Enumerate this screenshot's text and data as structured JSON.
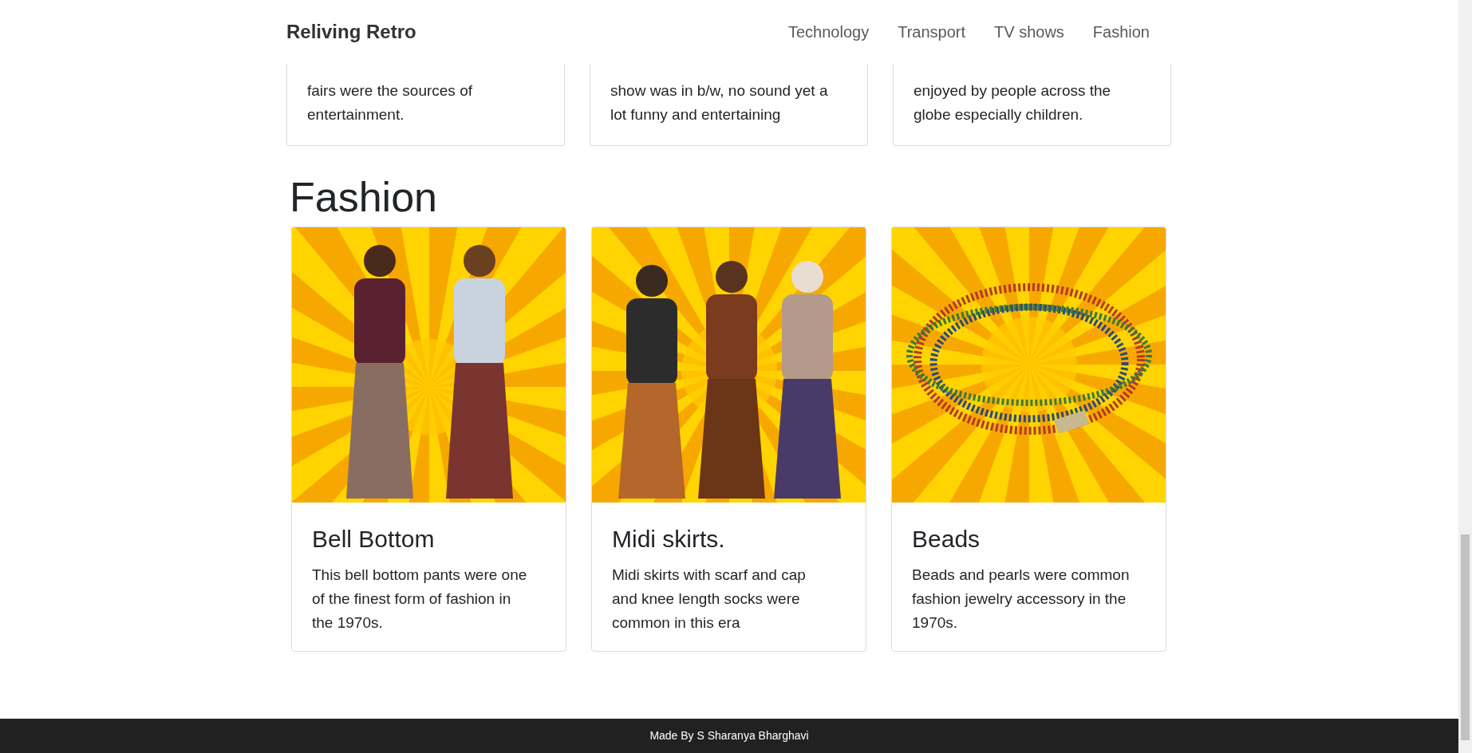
{
  "navbar": {
    "brand": "Reliving Retro",
    "links": [
      "Technology",
      "Transport",
      "TV shows",
      "Fashion"
    ]
  },
  "previous_cards": [
    {
      "text": "fairs were the sources of entertainment."
    },
    {
      "text": "show was in b/w, no sound yet a lot funny and entertaining"
    },
    {
      "text": "enjoyed by people across the globe especially children."
    }
  ],
  "section": {
    "heading": "Fashion",
    "cards": [
      {
        "title": "Bell Bottom",
        "text": "This bell bottom pants were one of the finest form of fashion in the 1970s."
      },
      {
        "title": "Midi skirts.",
        "text": "Midi skirts with scarf and cap and knee length socks were common in this era"
      },
      {
        "title": "Beads",
        "text": "Beads and pearls were common fashion jewelry accessory in the 1970s."
      }
    ]
  },
  "footer": {
    "text": "Made By S Sharanya Bharghavi"
  }
}
